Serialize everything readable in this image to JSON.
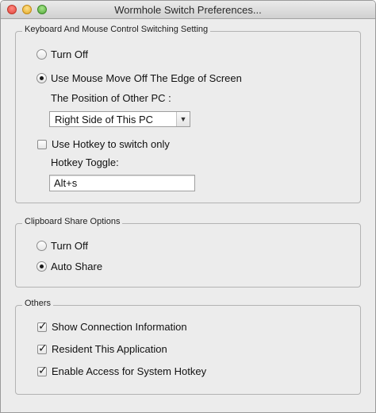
{
  "window": {
    "title": "Wormhole Switch Preferences..."
  },
  "kbm": {
    "legend": "Keyboard And Mouse Control Switching Setting",
    "option_off": "Turn Off",
    "option_edge": "Use Mouse Move Off The Edge of Screen",
    "position_label": "The Position of Other PC :",
    "position_value": "Right Side of This PC",
    "hotkey_check": "Use Hotkey to switch only",
    "hotkey_toggle_label": "Hotkey Toggle:",
    "hotkey_value": "Alt+s"
  },
  "clipboard": {
    "legend": "Clipboard Share Options",
    "option_off": "Turn Off",
    "option_auto": "Auto Share"
  },
  "others": {
    "legend": "Others",
    "show_connection": "Show Connection Information",
    "resident": "Resident This Application",
    "system_hotkey": "Enable Access for System Hotkey"
  }
}
